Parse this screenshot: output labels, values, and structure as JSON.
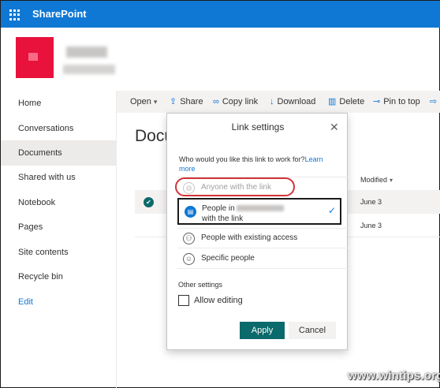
{
  "app": {
    "name": "SharePoint"
  },
  "nav": {
    "items": [
      {
        "label": "Home"
      },
      {
        "label": "Conversations"
      },
      {
        "label": "Documents"
      },
      {
        "label": "Shared with us"
      },
      {
        "label": "Notebook"
      },
      {
        "label": "Pages"
      },
      {
        "label": "Site contents"
      },
      {
        "label": "Recycle bin"
      }
    ],
    "edit_label": "Edit"
  },
  "commands": {
    "open": "Open",
    "share": "Share",
    "copy_link": "Copy link",
    "download": "Download",
    "delete": "Delete",
    "pin_to_top": "Pin to top"
  },
  "library": {
    "title": "Documents",
    "modified_header": "Modified",
    "rows": [
      {
        "modified": "June 3"
      },
      {
        "modified": "June 3"
      }
    ]
  },
  "dialog": {
    "title": "Link settings",
    "question": "Who would you like this link to work for?",
    "learn_more": "Learn more",
    "options": {
      "anyone": "Anyone with the link",
      "people_in_prefix": "People in",
      "people_in_suffix": "with the link",
      "existing": "People with existing access",
      "specific": "Specific people"
    },
    "other_settings": "Other settings",
    "allow_editing": "Allow editing",
    "apply": "Apply",
    "cancel": "Cancel"
  },
  "watermark": "www.wintips.org",
  "colors": {
    "accent": "#0f78d4",
    "teal": "#0b6a6b",
    "highlight": "#d13438"
  }
}
